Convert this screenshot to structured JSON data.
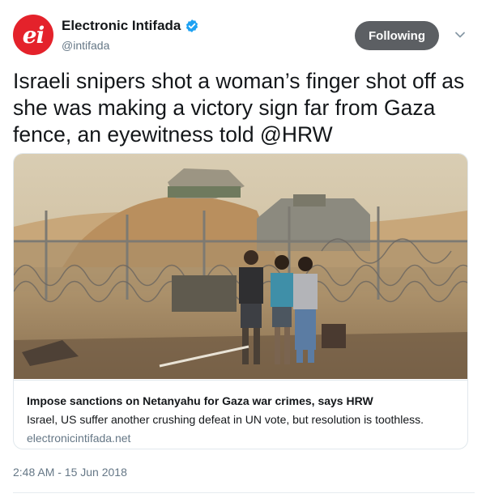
{
  "author": {
    "avatar_text": "ei",
    "name": "Electronic Intifada",
    "handle": "@intifada",
    "verified": true
  },
  "follow_button": {
    "label": "Following"
  },
  "tweet": {
    "text": "Israeli snipers shot a woman’s finger shot off as she was making a victory sign far from Gaza fence, an eyewitness told @HRW",
    "timestamp": "2:48 AM - 15 Jun 2018"
  },
  "card": {
    "title": "Impose sanctions on Netanyahu for Gaza war crimes, says HRW",
    "description": "Israel, US suffer another crushing defeat in UN vote, but resolution is toothless.",
    "domain": "electronicintifada.net"
  },
  "colors": {
    "avatar_bg": "#e4222b",
    "verified_blue": "#1da1f2",
    "button_bg": "#5c5f63",
    "muted_text": "#657786"
  },
  "icons": [
    "verified-badge-icon",
    "chevron-down-icon"
  ]
}
